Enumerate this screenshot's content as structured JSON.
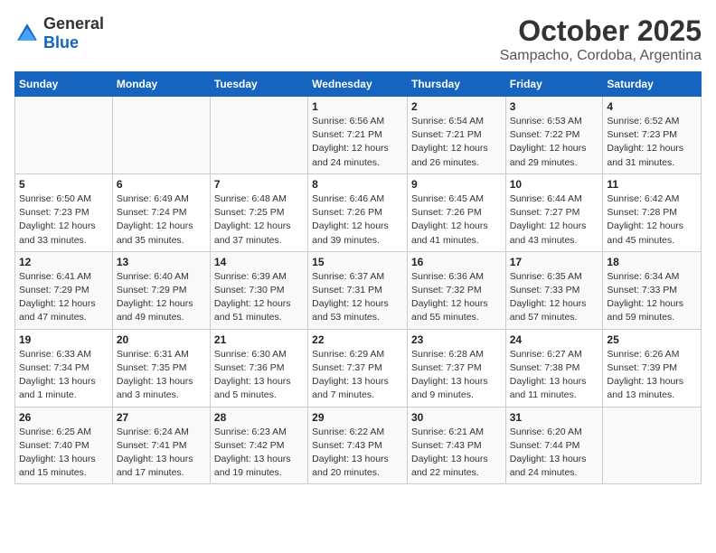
{
  "logo": {
    "text_general": "General",
    "text_blue": "Blue"
  },
  "title": "October 2025",
  "subtitle": "Sampacho, Cordoba, Argentina",
  "days_of_week": [
    "Sunday",
    "Monday",
    "Tuesday",
    "Wednesday",
    "Thursday",
    "Friday",
    "Saturday"
  ],
  "weeks": [
    [
      {
        "day": "",
        "info": ""
      },
      {
        "day": "",
        "info": ""
      },
      {
        "day": "",
        "info": ""
      },
      {
        "day": "1",
        "info": "Sunrise: 6:56 AM\nSunset: 7:21 PM\nDaylight: 12 hours and 24 minutes."
      },
      {
        "day": "2",
        "info": "Sunrise: 6:54 AM\nSunset: 7:21 PM\nDaylight: 12 hours and 26 minutes."
      },
      {
        "day": "3",
        "info": "Sunrise: 6:53 AM\nSunset: 7:22 PM\nDaylight: 12 hours and 29 minutes."
      },
      {
        "day": "4",
        "info": "Sunrise: 6:52 AM\nSunset: 7:23 PM\nDaylight: 12 hours and 31 minutes."
      }
    ],
    [
      {
        "day": "5",
        "info": "Sunrise: 6:50 AM\nSunset: 7:23 PM\nDaylight: 12 hours and 33 minutes."
      },
      {
        "day": "6",
        "info": "Sunrise: 6:49 AM\nSunset: 7:24 PM\nDaylight: 12 hours and 35 minutes."
      },
      {
        "day": "7",
        "info": "Sunrise: 6:48 AM\nSunset: 7:25 PM\nDaylight: 12 hours and 37 minutes."
      },
      {
        "day": "8",
        "info": "Sunrise: 6:46 AM\nSunset: 7:26 PM\nDaylight: 12 hours and 39 minutes."
      },
      {
        "day": "9",
        "info": "Sunrise: 6:45 AM\nSunset: 7:26 PM\nDaylight: 12 hours and 41 minutes."
      },
      {
        "day": "10",
        "info": "Sunrise: 6:44 AM\nSunset: 7:27 PM\nDaylight: 12 hours and 43 minutes."
      },
      {
        "day": "11",
        "info": "Sunrise: 6:42 AM\nSunset: 7:28 PM\nDaylight: 12 hours and 45 minutes."
      }
    ],
    [
      {
        "day": "12",
        "info": "Sunrise: 6:41 AM\nSunset: 7:29 PM\nDaylight: 12 hours and 47 minutes."
      },
      {
        "day": "13",
        "info": "Sunrise: 6:40 AM\nSunset: 7:29 PM\nDaylight: 12 hours and 49 minutes."
      },
      {
        "day": "14",
        "info": "Sunrise: 6:39 AM\nSunset: 7:30 PM\nDaylight: 12 hours and 51 minutes."
      },
      {
        "day": "15",
        "info": "Sunrise: 6:37 AM\nSunset: 7:31 PM\nDaylight: 12 hours and 53 minutes."
      },
      {
        "day": "16",
        "info": "Sunrise: 6:36 AM\nSunset: 7:32 PM\nDaylight: 12 hours and 55 minutes."
      },
      {
        "day": "17",
        "info": "Sunrise: 6:35 AM\nSunset: 7:33 PM\nDaylight: 12 hours and 57 minutes."
      },
      {
        "day": "18",
        "info": "Sunrise: 6:34 AM\nSunset: 7:33 PM\nDaylight: 12 hours and 59 minutes."
      }
    ],
    [
      {
        "day": "19",
        "info": "Sunrise: 6:33 AM\nSunset: 7:34 PM\nDaylight: 13 hours and 1 minute."
      },
      {
        "day": "20",
        "info": "Sunrise: 6:31 AM\nSunset: 7:35 PM\nDaylight: 13 hours and 3 minutes."
      },
      {
        "day": "21",
        "info": "Sunrise: 6:30 AM\nSunset: 7:36 PM\nDaylight: 13 hours and 5 minutes."
      },
      {
        "day": "22",
        "info": "Sunrise: 6:29 AM\nSunset: 7:37 PM\nDaylight: 13 hours and 7 minutes."
      },
      {
        "day": "23",
        "info": "Sunrise: 6:28 AM\nSunset: 7:37 PM\nDaylight: 13 hours and 9 minutes."
      },
      {
        "day": "24",
        "info": "Sunrise: 6:27 AM\nSunset: 7:38 PM\nDaylight: 13 hours and 11 minutes."
      },
      {
        "day": "25",
        "info": "Sunrise: 6:26 AM\nSunset: 7:39 PM\nDaylight: 13 hours and 13 minutes."
      }
    ],
    [
      {
        "day": "26",
        "info": "Sunrise: 6:25 AM\nSunset: 7:40 PM\nDaylight: 13 hours and 15 minutes."
      },
      {
        "day": "27",
        "info": "Sunrise: 6:24 AM\nSunset: 7:41 PM\nDaylight: 13 hours and 17 minutes."
      },
      {
        "day": "28",
        "info": "Sunrise: 6:23 AM\nSunset: 7:42 PM\nDaylight: 13 hours and 19 minutes."
      },
      {
        "day": "29",
        "info": "Sunrise: 6:22 AM\nSunset: 7:43 PM\nDaylight: 13 hours and 20 minutes."
      },
      {
        "day": "30",
        "info": "Sunrise: 6:21 AM\nSunset: 7:43 PM\nDaylight: 13 hours and 22 minutes."
      },
      {
        "day": "31",
        "info": "Sunrise: 6:20 AM\nSunset: 7:44 PM\nDaylight: 13 hours and 24 minutes."
      },
      {
        "day": "",
        "info": ""
      }
    ]
  ]
}
